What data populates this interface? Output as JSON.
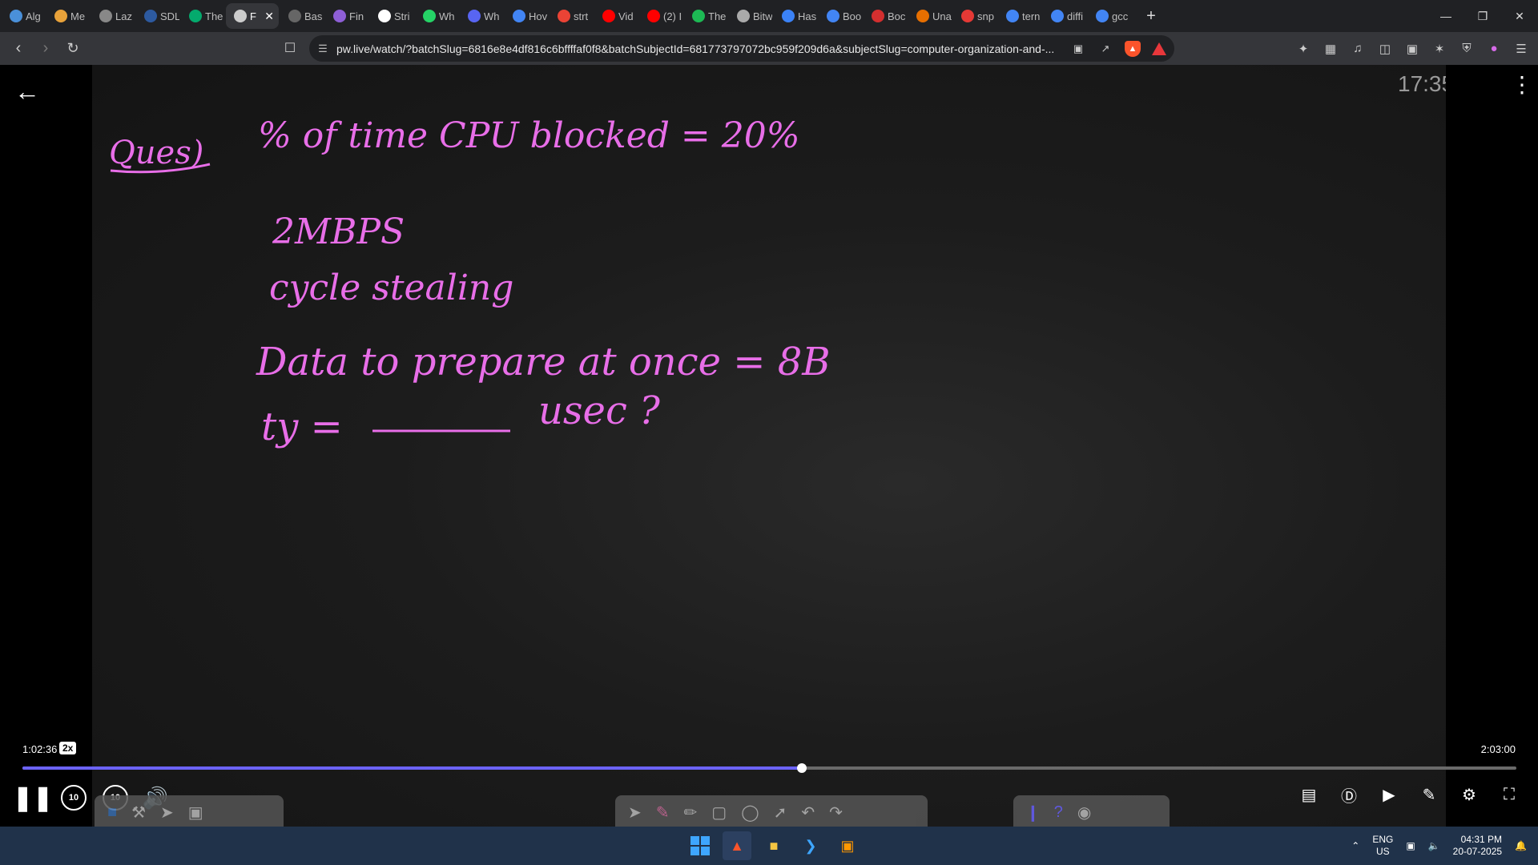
{
  "browser": {
    "tabs": [
      {
        "label": "Alg",
        "icon": "globe-icon",
        "color": "#4a90d9"
      },
      {
        "label": "Me",
        "icon": "medium-icon",
        "color": "#e8a23a"
      },
      {
        "label": "Laz",
        "icon": "globe-icon",
        "color": "#888888"
      },
      {
        "label": "SDL",
        "icon": "sdl-icon",
        "color": "#2d5aa0"
      },
      {
        "label": "The",
        "icon": "w3schools-icon",
        "color": "#04aa6d"
      },
      {
        "label": "F",
        "icon": "speaker-icon",
        "color": "#cccccc",
        "active": true
      },
      {
        "label": "Bas",
        "icon": "basics-icon",
        "color": "#666666"
      },
      {
        "label": "Fin",
        "icon": "finance-icon",
        "color": "#8e5fd6"
      },
      {
        "label": "Stri",
        "icon": "string-icon",
        "color": "#ffffff"
      },
      {
        "label": "Wh",
        "icon": "whatsapp-icon",
        "color": "#25d366"
      },
      {
        "label": "Wh",
        "icon": "shield-icon",
        "color": "#5865f2"
      },
      {
        "label": "Hov",
        "icon": "hover-icon",
        "color": "#4285f4"
      },
      {
        "label": "strt",
        "icon": "google-icon",
        "color": "#ea4335"
      },
      {
        "label": "Vid",
        "icon": "youtube-icon",
        "color": "#ff0000"
      },
      {
        "label": "(2) I",
        "icon": "youtube-icon",
        "color": "#ff0000"
      },
      {
        "label": "The",
        "icon": "spotify-icon",
        "color": "#1db954"
      },
      {
        "label": "Bitw",
        "icon": "bitwise-icon",
        "color": "#aaaaaa"
      },
      {
        "label": "Has",
        "icon": "f-icon",
        "color": "#3b82f6"
      },
      {
        "label": "Boo",
        "icon": "google-icon",
        "color": "#4285f4"
      },
      {
        "label": "Boc",
        "icon": "bookmark-red-icon",
        "color": "#d32f2f"
      },
      {
        "label": "Una",
        "icon": "java-icon",
        "color": "#e76f00"
      },
      {
        "label": "snp",
        "icon": "snip-icon",
        "color": "#e53935"
      },
      {
        "label": "tern",
        "icon": "google-icon",
        "color": "#4285f4"
      },
      {
        "label": "diffi",
        "icon": "google-icon",
        "color": "#4285f4"
      },
      {
        "label": "gcc",
        "icon": "google-icon",
        "color": "#4285f4"
      }
    ],
    "new_tab": "+",
    "url": "pw.live/watch/?batchSlug=6816e8e4df816c6bffffaf0f8&batchSubjectId=681773797072bc959f209d6a&subjectSlug=computer-organization-and-..."
  },
  "video": {
    "top_time": "17:35",
    "notes": {
      "heading": "Ques)",
      "line1": "% of time CPU blocked = 20%",
      "line2": "2MBPS",
      "line3": "cycle stealing",
      "line4": "Data to prepare at once = 8B",
      "line5_prefix": "ty =",
      "line5_suffix": "usec ?"
    },
    "accent_color": "#e86ee8",
    "current_time": "1:02:36",
    "speed": "2x",
    "total_time": "2:03:00",
    "progress": 0.5215,
    "seek_back": "10",
    "seek_fwd": "10"
  },
  "taskbar": {
    "lang_top": "ENG",
    "lang_bottom": "US",
    "time": "04:31 PM",
    "date": "20-07-2025"
  }
}
